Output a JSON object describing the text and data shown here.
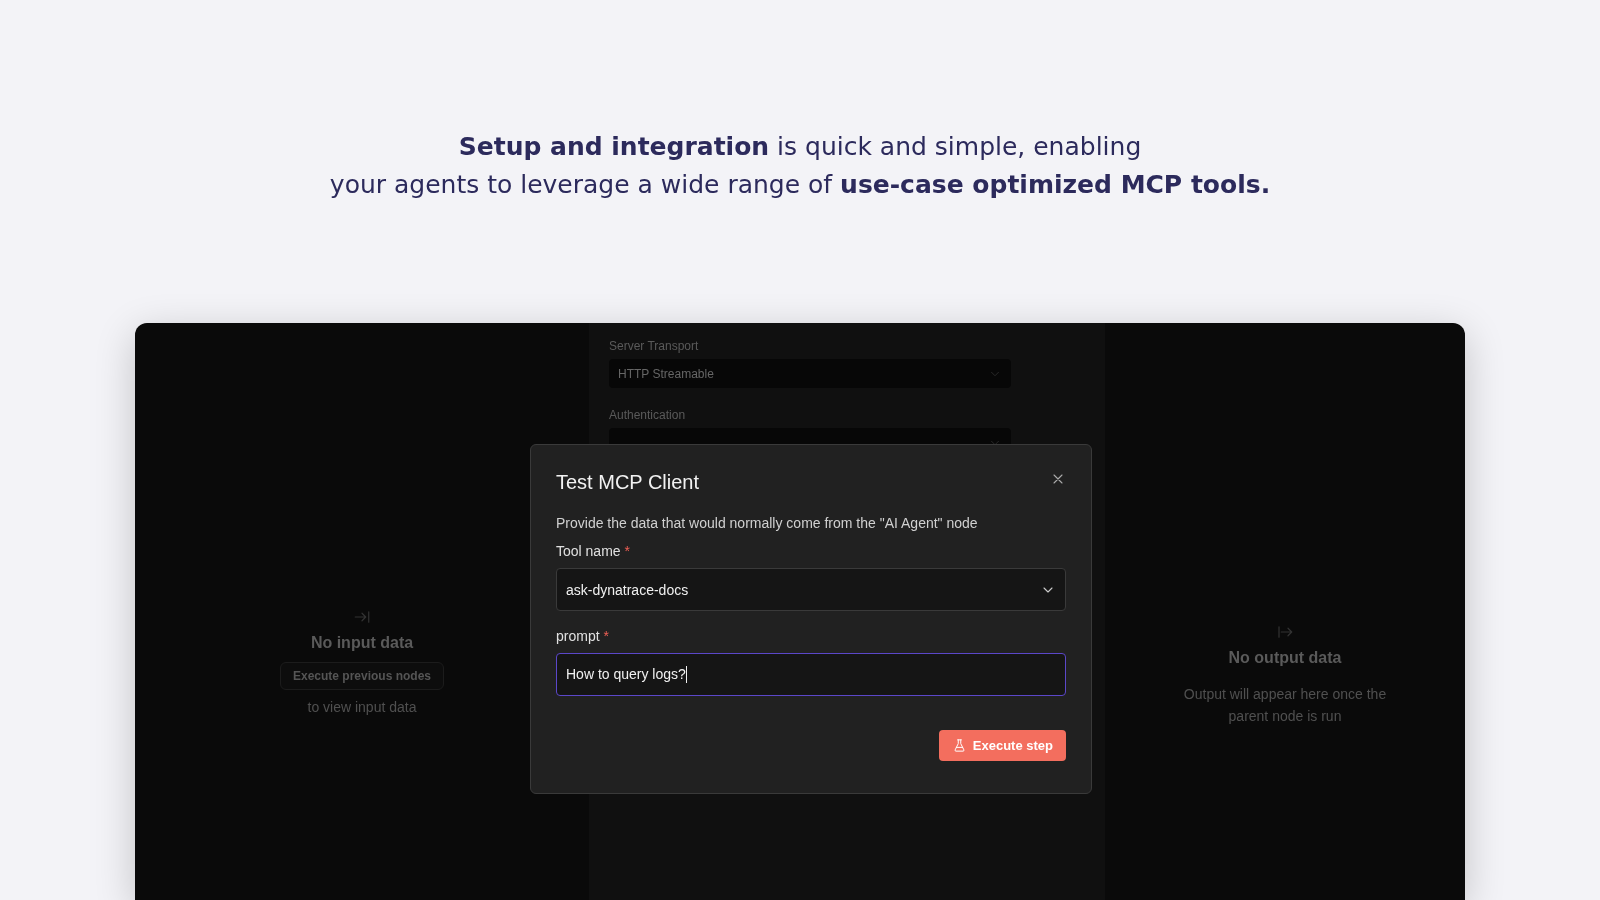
{
  "headline": [
    "**Setup and integration** is quick and simple, enabling",
    "your agents to leverage a wide range of **use-case optimized MCP tools.**"
  ],
  "input_panel": {
    "title": "No input data",
    "button": "Execute previous nodes",
    "hint": "to view input data"
  },
  "settings": [
    {
      "label": "Server Transport",
      "value": "HTTP Streamable"
    },
    {
      "label": "Authentication"
    }
  ],
  "output_panel": {
    "title": "No output data",
    "hint": "Output will appear here once the parent node is run"
  },
  "dialog": {
    "title": "Test MCP Client",
    "description": "Provide the data that would normally come from the \"AI Agent\" node",
    "fields": [
      {
        "kind": "select",
        "label": "Tool name",
        "required_mark": "*",
        "value": "ask-dynatrace-docs",
        "focused": false
      },
      {
        "kind": "input",
        "label": "prompt",
        "required_mark": "*",
        "value": "How to query logs?",
        "focused": true
      }
    ],
    "button": "Execute step"
  }
}
